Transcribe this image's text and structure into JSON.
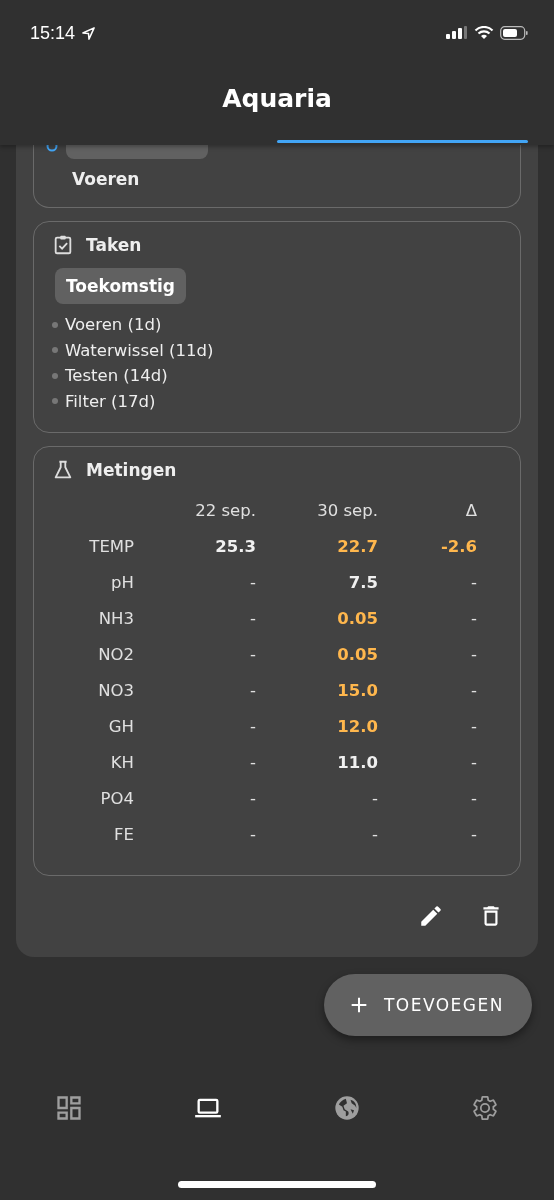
{
  "status_bar": {
    "time": "15:14"
  },
  "header": {
    "title": "Aquaria"
  },
  "event_card": {
    "task": "Voeren"
  },
  "tasks_card": {
    "title": "Taken",
    "chip": "Toekomstig",
    "items": [
      "Voeren (1d)",
      "Waterwissel (11d)",
      "Testen (14d)",
      "Filter (17d)"
    ]
  },
  "measurements_card": {
    "title": "Metingen",
    "columns": [
      "22 sep.",
      "30 sep.",
      "Δ"
    ],
    "rows": [
      {
        "label": "TEMP",
        "cells": [
          {
            "text": "25.3",
            "bold": true,
            "warning": false
          },
          {
            "text": "22.7",
            "bold": true,
            "warning": true
          },
          {
            "text": "-2.6",
            "bold": true,
            "warning": true
          }
        ]
      },
      {
        "label": "pH",
        "cells": [
          {
            "text": "-",
            "bold": false,
            "warning": false
          },
          {
            "text": "7.5",
            "bold": true,
            "warning": false
          },
          {
            "text": "-",
            "bold": false,
            "warning": false
          }
        ]
      },
      {
        "label": "NH3",
        "cells": [
          {
            "text": "-",
            "bold": false,
            "warning": false
          },
          {
            "text": "0.05",
            "bold": true,
            "warning": true
          },
          {
            "text": "-",
            "bold": false,
            "warning": false
          }
        ]
      },
      {
        "label": "NO2",
        "cells": [
          {
            "text": "-",
            "bold": false,
            "warning": false
          },
          {
            "text": "0.05",
            "bold": true,
            "warning": true
          },
          {
            "text": "-",
            "bold": false,
            "warning": false
          }
        ]
      },
      {
        "label": "NO3",
        "cells": [
          {
            "text": "-",
            "bold": false,
            "warning": false
          },
          {
            "text": "15.0",
            "bold": true,
            "warning": true
          },
          {
            "text": "-",
            "bold": false,
            "warning": false
          }
        ]
      },
      {
        "label": "GH",
        "cells": [
          {
            "text": "-",
            "bold": false,
            "warning": false
          },
          {
            "text": "12.0",
            "bold": true,
            "warning": true
          },
          {
            "text": "-",
            "bold": false,
            "warning": false
          }
        ]
      },
      {
        "label": "KH",
        "cells": [
          {
            "text": "-",
            "bold": false,
            "warning": false
          },
          {
            "text": "11.0",
            "bold": true,
            "warning": false
          },
          {
            "text": "-",
            "bold": false,
            "warning": false
          }
        ]
      },
      {
        "label": "PO4",
        "cells": [
          {
            "text": "-",
            "bold": false,
            "warning": false
          },
          {
            "text": "-",
            "bold": false,
            "warning": false
          },
          {
            "text": "-",
            "bold": false,
            "warning": false
          }
        ]
      },
      {
        "label": "FE",
        "cells": [
          {
            "text": "-",
            "bold": false,
            "warning": false
          },
          {
            "text": "-",
            "bold": false,
            "warning": false
          },
          {
            "text": "-",
            "bold": false,
            "warning": false
          }
        ]
      }
    ]
  },
  "fab": {
    "label": "TOEVOEGEN"
  },
  "bottom_nav": [
    {
      "kind": "dashboard",
      "selected": false
    },
    {
      "kind": "laptop",
      "selected": true
    },
    {
      "kind": "globe",
      "selected": false
    },
    {
      "kind": "settings",
      "selected": false
    }
  ]
}
